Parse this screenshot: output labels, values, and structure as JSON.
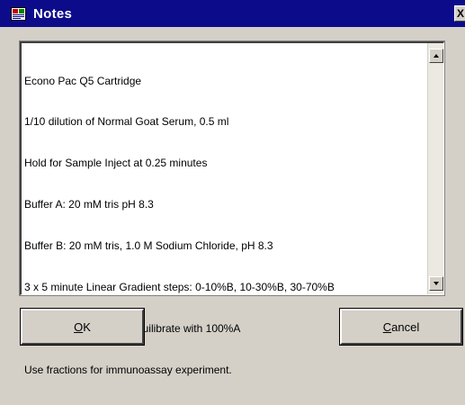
{
  "window": {
    "title": "Notes",
    "close_label": "X"
  },
  "notes": {
    "lines": [
      "Econo Pac Q5 Cartridge",
      "1/10 dilution of Normal Goat Serum, 0.5 ml",
      "Hold for Sample Inject at 0.25 minutes",
      "Buffer A: 20 mM tris pH 8.3",
      "Buffer B: 20 mM tris, 1.0 M Sodium Chloride, pH 8.3",
      "3 x 5 minute Linear Gradient steps: 0-10%B, 10-30%B, 30-70%B",
      "Wash with 100%B, re-equilibrate with 100%A",
      "Use fractions for immunoassay experiment."
    ]
  },
  "buttons": {
    "ok": {
      "accel": "O",
      "rest": "K"
    },
    "cancel": {
      "accel": "C",
      "rest": "ancel"
    }
  },
  "icons": {
    "app": "notes-app-icon",
    "close": "close-icon",
    "scroll_up": "scroll-up-arrow-icon",
    "scroll_down": "scroll-down-arrow-icon"
  },
  "colors": {
    "titlebar": "#0c0c8a",
    "face": "#d4d0c8",
    "text_area": "#ffffff"
  }
}
